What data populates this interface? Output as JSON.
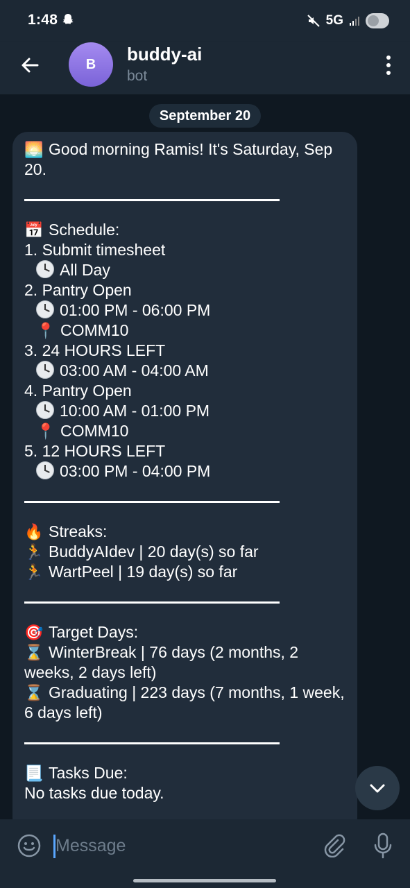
{
  "status_bar": {
    "time": "1:48",
    "network": "5G",
    "icons": [
      "snapchat-ghost-icon",
      "mute-icon",
      "signal-icon",
      "battery-toggle-icon"
    ]
  },
  "header": {
    "avatar_initial": "B",
    "title": "buddy-ai",
    "subtitle": "bot",
    "avatar_color": "#8e74e6"
  },
  "chat": {
    "date_label": "September 20",
    "message": {
      "greeting_icon": "sunrise-icon",
      "greeting": "Good morning Ramis! It's Saturday, Sep 20.",
      "schedule": {
        "icon": "calendar-icon",
        "heading": "Schedule:",
        "items": [
          {
            "title": "1. Submit timesheet",
            "time": "All Day",
            "location": null
          },
          {
            "title": "2. Pantry Open",
            "time": "01:00 PM - 06:00 PM",
            "location": "COMM10"
          },
          {
            "title": "3. 24 HOURS LEFT",
            "time": "03:00 AM - 04:00 AM",
            "location": null
          },
          {
            "title": "4. Pantry Open",
            "time": "10:00 AM - 01:00 PM",
            "location": "COMM10"
          },
          {
            "title": "5. 12 HOURS LEFT",
            "time": "03:00 PM - 04:00 PM",
            "location": null
          }
        ]
      },
      "streaks": {
        "icon": "fire-icon",
        "heading": "Streaks:",
        "items": [
          "BuddyAIdev | 20 day(s) so far",
          "WartPeel | 19 day(s) so far"
        ]
      },
      "targets": {
        "icon": "dart-icon",
        "heading": "Target Days:",
        "items": [
          "WinterBreak | 76 days (2 months, 2 weeks, 2 days left)",
          "Graduating | 223 days (7 months, 1 week, 6 days left)"
        ]
      },
      "tasks": {
        "icon": "scroll-icon",
        "heading": "Tasks Due:",
        "text": "No tasks due today."
      }
    }
  },
  "input": {
    "placeholder": "Message"
  },
  "colors": {
    "bubble": "#212d3b",
    "background": "#0f1821",
    "bar": "#1c2834"
  }
}
